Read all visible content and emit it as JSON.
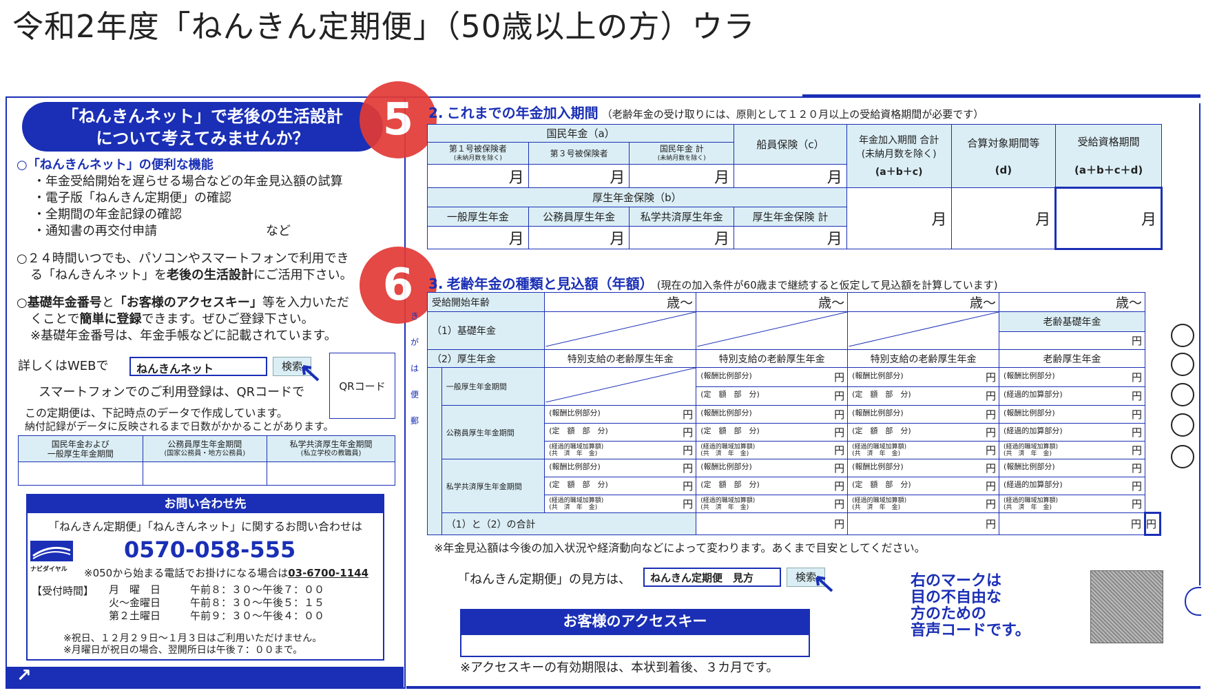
{
  "page_title": "令和2年度「ねんきん定期便」（50歳以上の方）ウラ",
  "badges": {
    "five": "5",
    "six": "6"
  },
  "left": {
    "headline_line1": "「ねんきんネット」で老後の生活設計",
    "headline_line2": "について考えてみませんか？",
    "features_title": "○「ねんきんネット」の便利な機能",
    "features": [
      "・年金受給開始を遅らせる場合などの年金見込額の試算",
      "・電子版「ねんきん定期便」の確認",
      "・全期間の年金記録の確認",
      "・通知書の再交付申請"
    ],
    "features_etc": "など",
    "p2_line1": "○２４時間いつでも、パソコンやスマートフォンで利用でき",
    "p2_line2_a": "る「ねんきんネット」を",
    "p2_line2_b": "老後の生活設計",
    "p2_line2_c": "にご活用下さい。",
    "p3_a": "○",
    "p3_b": "基礎年金番号",
    "p3_c": "と",
    "p3_d": "「お客様のアクセスキー」",
    "p3_e": "等を入力いただ",
    "p3_line2_a": "くことで",
    "p3_line2_b": "簡単に登録",
    "p3_line2_c": "できます。ぜひご登録下さい。",
    "p3_line3": "※基礎年金番号は、年金手帳などに記載されています。",
    "web_label": "詳しくはWEBで",
    "web_search_value": "ねんきんネット",
    "search_button": "検索",
    "qr_label": "QRコード",
    "smartphone_text": "スマートフォンでのご利用登録は、QRコードで",
    "data_note1": "この定期便は、下記時点のデータで作成しています。",
    "data_note2": "納付記録がデータに反映されるまで日数がかかることがあります。",
    "data_cols": [
      {
        "line1": "国民年金および",
        "line2": "一般厚生年金期間"
      },
      {
        "line1": "公務員厚生年金期間",
        "line2": "(国家公務員・地方公務員)"
      },
      {
        "line1": "私学共済厚生年金期間",
        "line2": "(私立学校の教職員)"
      }
    ],
    "contact": {
      "header": "お問い合わせ先",
      "sub": "「ねんきん定期便」「ねんきんネット」に関するお問い合わせは",
      "navi_label": "ナビダイヤル",
      "phone": "0570-058-555",
      "alt_note": "※050から始まる電話でお掛けになる場合は",
      "alt_phone": "03-6700-1144",
      "hours_label": "【受付時間】",
      "hours": [
        {
          "day": "月　曜　日",
          "time": "午前８：３０～午後７：００"
        },
        {
          "day": "火～金曜日",
          "time": "午前８：３０～午後５：１５"
        },
        {
          "day": "第２土曜日",
          "time": "午前９：３０～午後４：００"
        }
      ],
      "note1": "※祝日、１２月２９日～１月３日はご利用いただけません。",
      "note2": "※月曜日が祝日の場合、翌開所日は午後７：００まで。"
    },
    "corner_arrow": "↗"
  },
  "section2": {
    "number": "2.",
    "title": "これまでの年金加入期間",
    "note": "（老齢年金の受け取りには、原則として１２０月以上の受給資格期間が必要です）",
    "kokumin": "国民年金（a）",
    "col1": "第１号被保険者",
    "col1_sub": "(未納月数を除く)",
    "col2": "第３号被保険者",
    "col3": "国民年金 計",
    "col3_sub": "(未納月数を除く)",
    "senin": "船員保険（c）",
    "total_label1": "年金加入期間 合計",
    "total_label2": "(未納月数を除く)",
    "total_formula": "(a＋b＋c)",
    "target_label": "合算対象期間等",
    "target_formula": "(d)",
    "qual_label": "受給資格期間",
    "qual_formula": "(a＋b＋c＋d)",
    "kosei": "厚生年金保険（b）",
    "k1": "一般厚生年金",
    "k2": "公務員厚生年金",
    "k3": "私学共済厚生年金",
    "k4": "厚生年金保険 計",
    "month": "月"
  },
  "section3": {
    "number": "3.",
    "title": "老齢年金の種類と見込額（年額）",
    "note": "(現在の加入条件が60歳まで継続すると仮定して見込額を計算しています)",
    "start_age": "受給開始年齢",
    "age_unit": "歳～",
    "kiso": "（1）基礎年金",
    "rorei_kiso": "老齢基礎年金",
    "kosei": "（2）厚生年金",
    "tokubetsu": "特別支給の老齢厚生年金",
    "rorei_kosei": "老齢厚生年金",
    "ippan": "一般厚生年金期間",
    "komuin": "公務員厚生年金期間",
    "shigaku": "私学共済厚生年金期間",
    "hoshu": "(報酬比例部分)",
    "teigaku": "(定　額　部　分)",
    "keika": "(経過的加算部分)",
    "shokuiki_1": "(経過的職域加算額)",
    "shokuiki_2": "(共　済　年　金)",
    "total": "（1）と（2）の合計",
    "yen": "円",
    "footnote": "※年金見込額は今後の加入状況や経済動向などによって変わります。あくまで目安としてください。",
    "side_text": "き　が　は　便　郵"
  },
  "howto": {
    "label": "「ねんきん定期便」の見方は、",
    "search_value": "ねんきん定期便　見方",
    "button": "検索"
  },
  "access_key": {
    "header": "お客様のアクセスキー",
    "note": "※アクセスキーの有効期限は、本状到着後、３カ月です。"
  },
  "voice_code": [
    "右のマークは",
    "目の不自由な",
    "方のための",
    "音声コードです。"
  ]
}
